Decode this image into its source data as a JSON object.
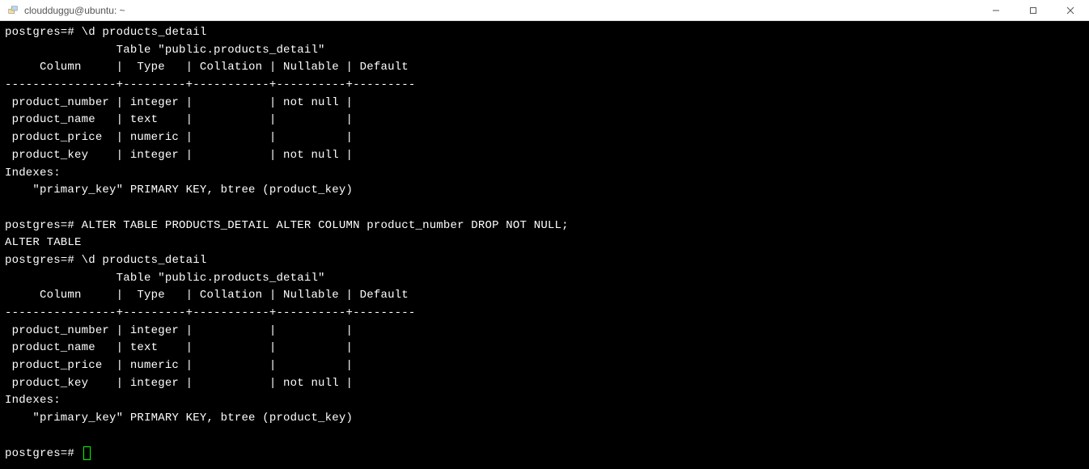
{
  "window": {
    "title": "cloudduggu@ubuntu: ~"
  },
  "terminal": {
    "prompt": "postgres=#",
    "lines": {
      "l1_cmd": "\\d products_detail",
      "l2_title": "                Table \"public.products_detail\"",
      "l3_header": "     Column     |  Type   | Collation | Nullable | Default",
      "l4_sep": "----------------+---------+-----------+----------+---------",
      "l5_row1": " product_number | integer |           | not null |",
      "l6_row2": " product_name   | text    |           |          |",
      "l7_row3": " product_price  | numeric |           |          |",
      "l8_row4": " product_key    | integer |           | not null |",
      "l9_idx": "Indexes:",
      "l10_idxline": "    \"primary_key\" PRIMARY KEY, btree (product_key)",
      "l11_blank": "",
      "l12_cmd": "ALTER TABLE PRODUCTS_DETAIL ALTER COLUMN product_number DROP NOT NULL;",
      "l13_resp": "ALTER TABLE",
      "l14_cmd": "\\d products_detail",
      "l15_title": "                Table \"public.products_detail\"",
      "l16_header": "     Column     |  Type   | Collation | Nullable | Default",
      "l17_sep": "----------------+---------+-----------+----------+---------",
      "l18_row1": " product_number | integer |           |          |",
      "l19_row2": " product_name   | text    |           |          |",
      "l20_row3": " product_price  | numeric |           |          |",
      "l21_row4": " product_key    | integer |           | not null |",
      "l22_idx": "Indexes:",
      "l23_idxline": "    \"primary_key\" PRIMARY KEY, btree (product_key)",
      "l24_blank": ""
    }
  }
}
